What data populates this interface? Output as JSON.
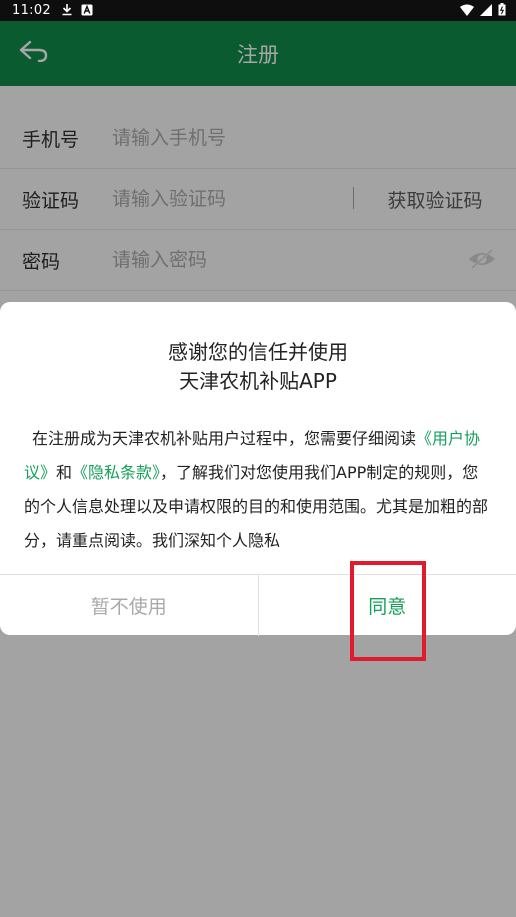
{
  "status_bar": {
    "time": "11:02",
    "icons": [
      "download-icon",
      "a-badge-icon",
      "wifi-icon",
      "signal-icon",
      "battery-icon"
    ]
  },
  "app_bar": {
    "title": "注册",
    "back_icon": "back-arrow-icon",
    "background": "#0b5b31"
  },
  "form": {
    "phone": {
      "label": "手机号",
      "placeholder": "请输入手机号",
      "value": ""
    },
    "code": {
      "label": "验证码",
      "placeholder": "请输入验证码",
      "value": "",
      "button": "获取验证码"
    },
    "password": {
      "label": "密码",
      "placeholder": "请输入密码",
      "value": "",
      "toggle_icon": "eye-hidden-icon"
    }
  },
  "dialog": {
    "title_line1": "感谢您的信任并使用",
    "title_line2": "天津农机补贴APP",
    "body": {
      "part1": "在注册成为天津农机补贴用户过程中，您需要仔细阅读",
      "link1": "《用户协议》",
      "and": "和",
      "link2": "《隐私条款》",
      "part2": "，了解我们对您使用我们APP制定的规则，您的个人信息处理以及申请权限的目的和使用范围。尤其是加粗的部分，请重点阅读。我们深知个人隐私"
    },
    "decline": "暂不使用",
    "agree": "同意"
  },
  "colors": {
    "accent": "#14a05a",
    "highlight": "#e01b2c"
  }
}
